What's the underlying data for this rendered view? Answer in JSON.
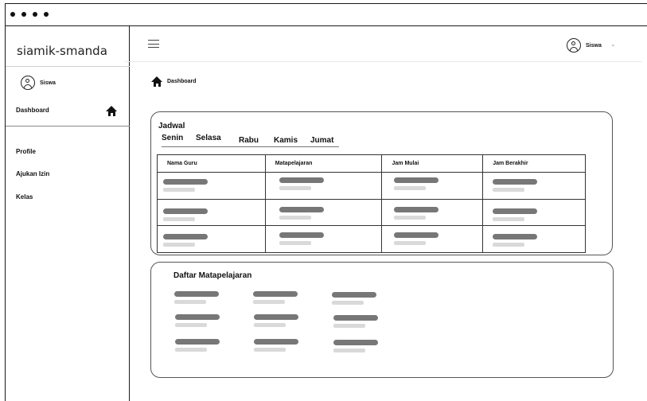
{
  "window_dots": 4,
  "sidebar": {
    "brand": "siamik-smanda",
    "user_label": "Siswa",
    "dashboard_label": "Dashboard",
    "items": [
      {
        "label": "Profile"
      },
      {
        "label": "Ajukan Izin"
      },
      {
        "label": "Kelas"
      }
    ]
  },
  "header": {
    "user_label": "Siswa",
    "chevron": "⌄"
  },
  "breadcrumb": {
    "label": "Dashboard"
  },
  "schedule": {
    "title": "Jadwal",
    "days": [
      "Senin",
      "Selasa",
      "Rabu",
      "Kamis",
      "Jumat"
    ],
    "columns": [
      "Nama Guru",
      "Matapelajaran",
      "Jam Mulai",
      "Jam Berakhir"
    ],
    "row_count": 3
  },
  "subjects": {
    "title": "Daftar Matapelajaran",
    "columns": 3,
    "rows": 3
  },
  "colors": {
    "border": "#1a1a1a",
    "placeholder_dark": "#777777",
    "placeholder_light": "#d9d9d9"
  }
}
